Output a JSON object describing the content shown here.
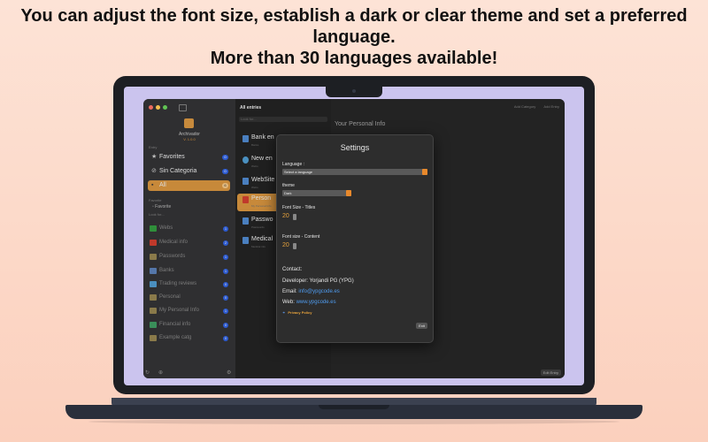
{
  "headline": {
    "line1": "You can adjust the font size, establish a dark or clear theme and set a preferred",
    "line2": "language.",
    "line3": "More than 30 languages available!"
  },
  "colors": {
    "accent": "#c7893a",
    "orange": "#e8892c",
    "badge": "#2d5bd1",
    "link": "#4f9cf0"
  },
  "sidebar": {
    "app_name": "Archivador",
    "app_version": "V. 1.0.0",
    "entry_section": "Entry",
    "nav": [
      {
        "icon": "star-icon",
        "label": "Favorites",
        "count": "0"
      },
      {
        "icon": "no-category-icon",
        "label": "Sin Categoria",
        "count": "0"
      },
      {
        "icon": "all-icon",
        "label": "All",
        "count": "6"
      }
    ],
    "favorite_section": "Favorite",
    "favorite_item": "Favorite",
    "look_for": "Look for...",
    "categories": [
      {
        "icon": "webs-icon",
        "label": "Webs",
        "count": "1",
        "color": "#2f8f3a"
      },
      {
        "icon": "medical-icon",
        "label": "Medical info",
        "count": "2",
        "color": "#c0392b"
      },
      {
        "icon": "folder-icon",
        "label": "Passwords",
        "count": "1",
        "color": "#8a7a4a"
      },
      {
        "icon": "bank-icon",
        "label": "Banks",
        "count": "1",
        "color": "#5577aa"
      },
      {
        "icon": "chart-icon",
        "label": "Trading reviews",
        "count": "0",
        "color": "#4a8fbf"
      },
      {
        "icon": "folder-icon",
        "label": "Personal",
        "count": "0",
        "color": "#8a7a4a"
      },
      {
        "icon": "folder-icon",
        "label": "My Personal Info",
        "count": "1",
        "color": "#8a7a4a"
      },
      {
        "icon": "shield-icon",
        "label": "Financial info",
        "count": "0",
        "color": "#3a8f5a"
      },
      {
        "icon": "folder-icon",
        "label": "Example catg",
        "count": "0",
        "color": "#8a7a4a"
      }
    ]
  },
  "list": {
    "title": "All entries",
    "search_placeholder": "Look for...",
    "entries": [
      {
        "label": "Bank en",
        "sub": "Banks",
        "color": "#4a7fbf"
      },
      {
        "label": "New en",
        "sub": "Webs",
        "color": "#4a90c0"
      },
      {
        "label": "WebSite",
        "sub": "Webs",
        "color": "#4a7fbf"
      },
      {
        "label": "Person",
        "sub": "My Personal Info",
        "color": "#c0392b"
      },
      {
        "label": "Passwo",
        "sub": "Passwords",
        "color": "#4a7fbf"
      },
      {
        "label": "Medical",
        "sub": "Medical info",
        "color": "#4a7fbf"
      }
    ]
  },
  "detail": {
    "add_category": "Add Category",
    "add_entry": "Add Entry",
    "title": "Your Personal Info",
    "edit_entry": "Edit Entry"
  },
  "settings": {
    "title": "Settings",
    "language_label": "Language :",
    "language_value": "Select a language",
    "theme_label": "theme",
    "theme_value": "Dark",
    "font_titles_label": "Font Size - Titles",
    "font_titles_value": "20",
    "font_content_label": "Font size - Content",
    "font_content_value": "20",
    "contact_heading": "Contact:",
    "developer": "Developer: Yorjandi PG (YPG)",
    "email_label": "Email:",
    "email_value": "info@ypgcode.es",
    "web_label": "Web:",
    "web_value": "www.ypgcode.es",
    "privacy": "Privacy Policy",
    "exit": "Exit"
  }
}
